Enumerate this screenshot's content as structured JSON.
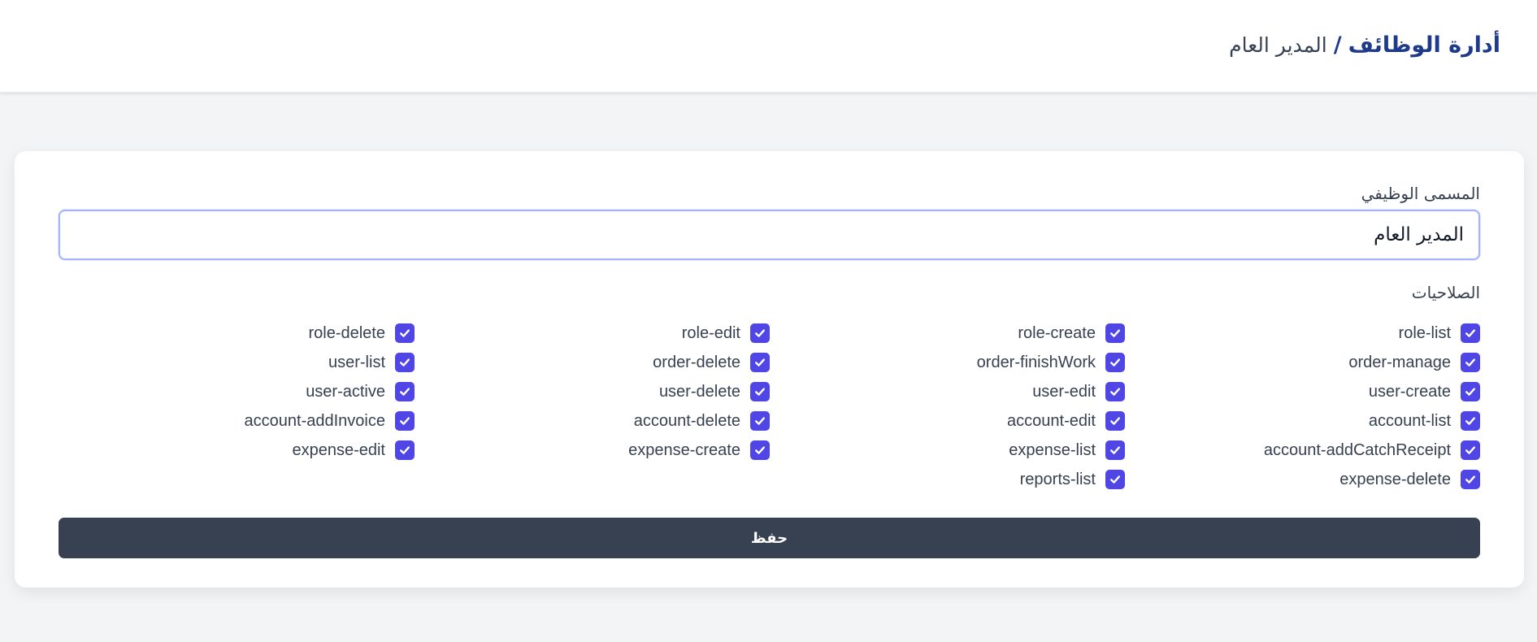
{
  "header": {
    "breadcrumb_root": "أدارة الوظائف",
    "breadcrumb_separator": "/",
    "breadcrumb_current": "المدير العام"
  },
  "form": {
    "job_title_label": "المسمى الوظيفي",
    "job_title_value": "المدير العام",
    "permissions_label": "الصلاحيات",
    "save_label": "حفظ"
  },
  "permissions": [
    "role-list",
    "role-create",
    "role-edit",
    "role-delete",
    "order-manage",
    "order-finishWork",
    "order-delete",
    "user-list",
    "user-create",
    "user-edit",
    "user-delete",
    "user-active",
    "account-list",
    "account-edit",
    "account-delete",
    "account-addInvoice",
    "account-addCatchReceipt",
    "expense-list",
    "expense-create",
    "expense-edit",
    "expense-delete",
    "reports-list"
  ],
  "colors": {
    "accent": "#4f46e5",
    "title_blue": "#1e3a8a",
    "button_dark": "#374151"
  }
}
